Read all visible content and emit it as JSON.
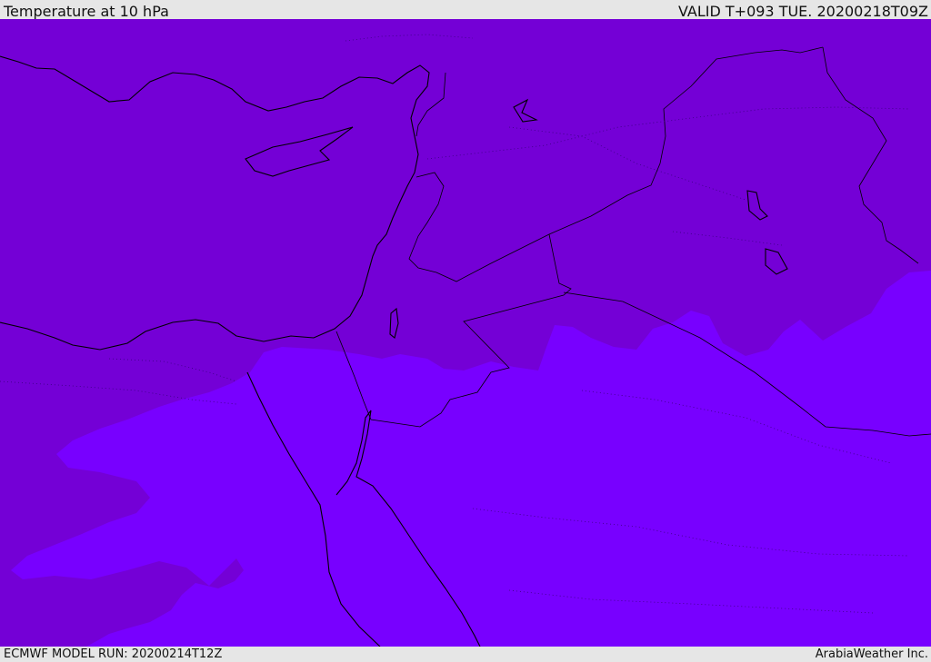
{
  "header": {
    "title": "Temperature at 10 hPa",
    "valid": "VALID T+093 TUE. 20200218T09Z"
  },
  "footer": {
    "model_run": "ECMWF MODEL RUN: 20200214T12Z",
    "credit": "ArabiaWeather Inc."
  },
  "map": {
    "colors": {
      "cold_band": "#7400d6",
      "warm_band": "#7800ff",
      "coast": "#000000",
      "dotted_contour": "#3a0080"
    }
  }
}
